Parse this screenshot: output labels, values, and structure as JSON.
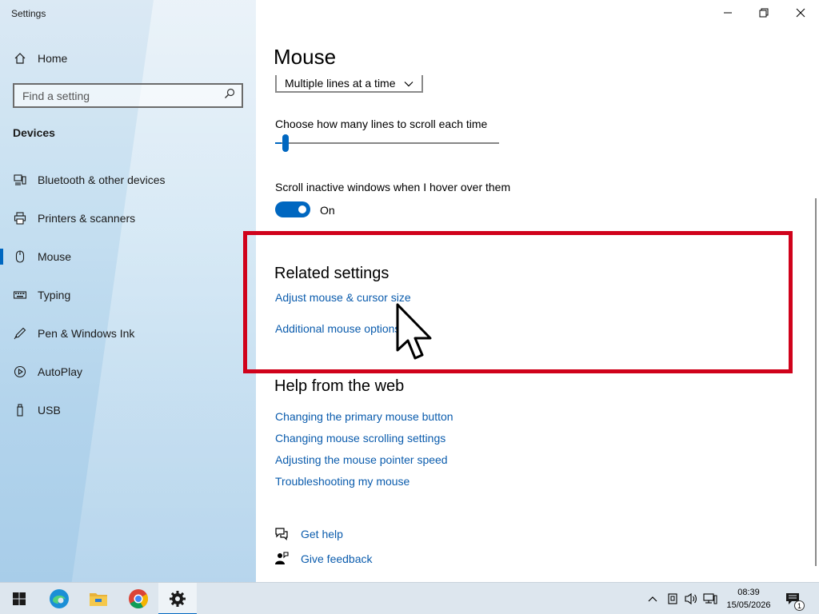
{
  "window": {
    "title": "Settings"
  },
  "sidebar": {
    "home_label": "Home",
    "search_placeholder": "Find a setting",
    "section_header": "Devices",
    "items": [
      {
        "label": "Bluetooth & other devices",
        "icon": "bluetooth-devices-icon"
      },
      {
        "label": "Printers & scanners",
        "icon": "printer-icon"
      },
      {
        "label": "Mouse",
        "icon": "mouse-icon",
        "active": true
      },
      {
        "label": "Typing",
        "icon": "keyboard-icon"
      },
      {
        "label": "Pen & Windows Ink",
        "icon": "pen-icon"
      },
      {
        "label": "AutoPlay",
        "icon": "autoplay-icon"
      },
      {
        "label": "USB",
        "icon": "usb-icon"
      }
    ]
  },
  "main": {
    "title": "Mouse",
    "scroll_mode_value": "Multiple lines at a time",
    "lines_label": "Choose how many lines to scroll each time",
    "lines_slider_fraction": 0.03,
    "inactive_label": "Scroll inactive windows when I hover over them",
    "inactive_toggle_state": "On",
    "related": {
      "heading": "Related settings",
      "links": [
        "Adjust mouse & cursor size",
        "Additional mouse options"
      ]
    },
    "help_web": {
      "heading": "Help from the web",
      "links": [
        "Changing the primary mouse button",
        "Changing mouse scrolling settings",
        "Adjusting the mouse pointer speed",
        "Troubleshooting my mouse"
      ]
    },
    "get_help": "Get help",
    "give_feedback": "Give feedback"
  },
  "taskbar": {
    "time": "08:39",
    "date": "15/05/2026",
    "notification_count": "1"
  },
  "colors": {
    "accent": "#0067c0",
    "link": "#0b5cad",
    "highlight_box": "#d0021b"
  }
}
